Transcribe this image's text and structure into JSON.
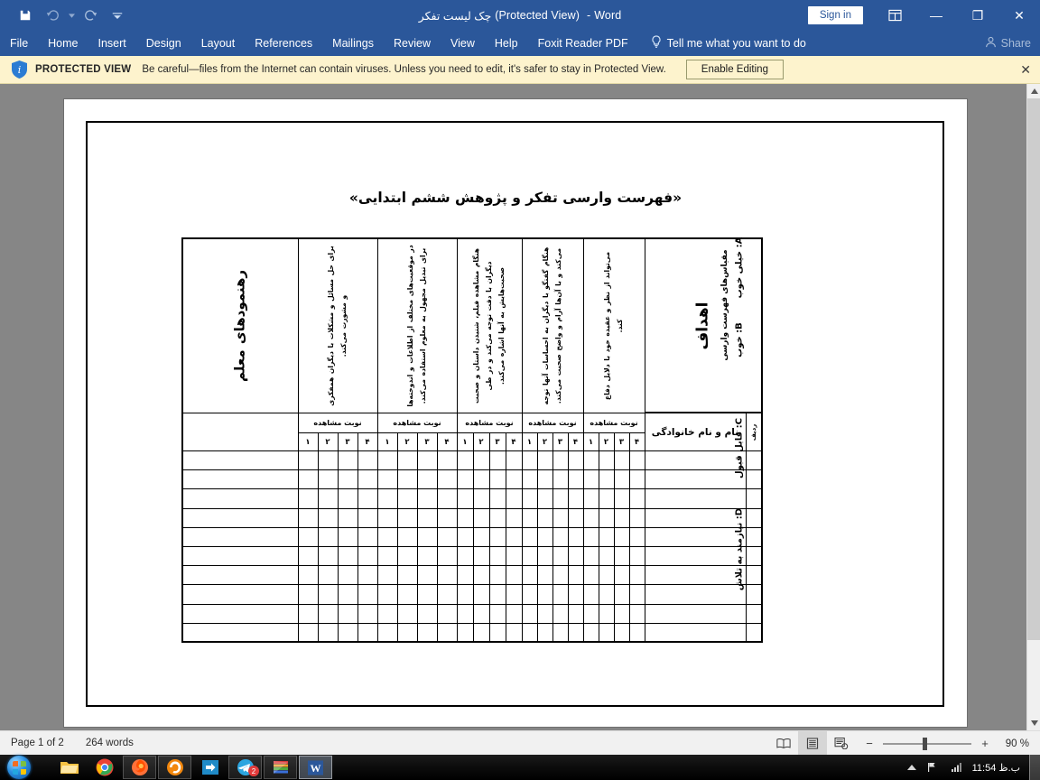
{
  "titlebar": {
    "save_icon": "save-icon",
    "undo_icon": "undo-icon",
    "redo_icon": "redo-icon",
    "customize_icon": "chevron-down-icon",
    "document_name": "چک لیست تفکر",
    "protected_suffix": "(Protected View)",
    "app_name": "Word",
    "separator": "-",
    "signin_label": "Sign in",
    "ribbon_display_icon": "ribbon-display-options-icon",
    "minimize_label": "—",
    "restore_label": "❐",
    "close_label": "✕"
  },
  "ribbon": {
    "tabs": [
      {
        "label": "File"
      },
      {
        "label": "Home"
      },
      {
        "label": "Insert"
      },
      {
        "label": "Design"
      },
      {
        "label": "Layout"
      },
      {
        "label": "References"
      },
      {
        "label": "Mailings"
      },
      {
        "label": "Review"
      },
      {
        "label": "View"
      },
      {
        "label": "Help"
      },
      {
        "label": "Foxit Reader PDF"
      }
    ],
    "tellme_icon": "lightbulb-icon",
    "tellme_label": "Tell me what you want to do",
    "share_icon": "share-person-icon",
    "share_label": "Share"
  },
  "protected_view": {
    "info_icon": "shield-info-icon",
    "title": "PROTECTED VIEW",
    "message": "Be careful—files from the Internet can contain viruses. Unless you need to edit, it's safer to stay in Protected View.",
    "button_label": "Enable Editing",
    "close_icon": "close-icon",
    "close_label": "✕"
  },
  "document": {
    "title": "«فهرست وارسی تفکر و پژوهش ششم ابتدایی»",
    "table": {
      "goals_header": "اهداف",
      "teacher_guidelines_header": "رهنمودهای معلم",
      "name_header": "نام و نام خانوادگی",
      "row_number_header": "ردیف",
      "observation_label": "نوبت مشاهده",
      "observation_numbers": [
        "۴",
        "۳",
        "۲",
        "۱"
      ],
      "objective_columns": [
        "برای حل مسائل و مشکلات با دیگران همفکری و مشورت می‌کند.",
        "در موقعیت‌های مختلف از اطلاعات و اندوخته‌ها برای تبدیل مجهول به معلوم استفاده می‌کند.",
        "هنگام مشاهده فیلم، شنیدن داستان و صحبت دیگران با دقت توجه می‌کند و در طی صحبت‌هایش به آنها اشاره می‌کند.",
        "هنگام گفتگو با دیگران به احساسات آنها توجه می‌کند و با آن‌ها آرام و واضح صحبت می‌کند.",
        "می‌تواند از نظر و عقیده خود با دلایل دفاع کند."
      ],
      "data_row_count": 10
    },
    "scale_legend": {
      "title": "مقیاس‌های فهرست وارسی",
      "items": [
        {
          "code": "A",
          "label": "خیلی خوب"
        },
        {
          "code": "B",
          "label": "خوب"
        },
        {
          "code": "C",
          "label": "قابل قبول"
        },
        {
          "code": "D",
          "label": "نیازمند به تلاش"
        }
      ]
    }
  },
  "statusbar": {
    "page_label": "Page 1 of 2",
    "word_count": "264 words",
    "view_read_icon": "read-mode-icon",
    "view_print_icon": "print-layout-icon",
    "view_web_icon": "web-layout-icon",
    "zoom_out_label": "−",
    "zoom_in_label": "+",
    "zoom_value": "90 %"
  },
  "taskbar": {
    "start_icon": "windows-start-orb-icon",
    "items": [
      {
        "icon": "file-explorer-icon",
        "name": "file-explorer"
      },
      {
        "icon": "chrome-icon",
        "name": "google-chrome"
      },
      {
        "icon": "firefox-icon",
        "name": "mozilla-firefox"
      },
      {
        "icon": "internet-download-manager-icon",
        "name": "internet-download-manager"
      },
      {
        "icon": "export-arrow-icon",
        "name": "export-tool"
      },
      {
        "icon": "telegram-icon",
        "name": "telegram",
        "badge": "2"
      },
      {
        "icon": "winrar-icon",
        "name": "winrar"
      },
      {
        "icon": "word-icon",
        "name": "microsoft-word"
      }
    ],
    "tray": {
      "expand_icon": "show-hidden-icons-icon",
      "network_icon": "network-icon",
      "volume_icon": "volume-icon",
      "clock": "11:54 ب.ظ"
    }
  },
  "scrollbar": {
    "up_icon": "chevron-up-icon",
    "down_icon": "chevron-down-icon"
  }
}
